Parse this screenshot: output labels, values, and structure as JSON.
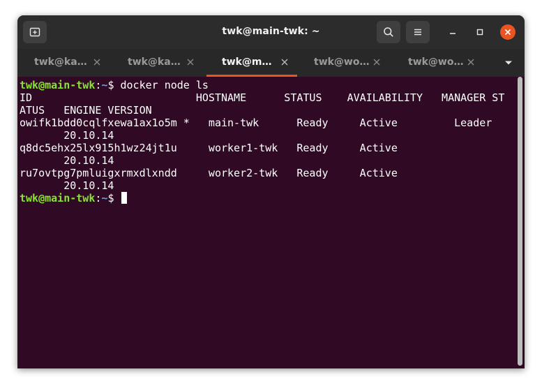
{
  "window": {
    "title": "twk@main-twk: ~"
  },
  "tabs": [
    {
      "label": "twk@ka…",
      "active": false
    },
    {
      "label": "twk@ka…",
      "active": false
    },
    {
      "label": "twk@m…",
      "active": true
    },
    {
      "label": "twk@wo…",
      "active": false
    },
    {
      "label": "twk@wo…",
      "active": false
    }
  ],
  "terminal": {
    "prompt_user": "twk@main-twk",
    "prompt_sep": ":",
    "prompt_path": "~",
    "prompt_symbol": "$ ",
    "command": "docker node ls",
    "output_lines": [
      "ID                          HOSTNAME      STATUS    AVAILABILITY   MANAGER ST",
      "ATUS   ENGINE VERSION",
      "owifk1bdd0cqlfxewa1ax1o5m *   main-twk      Ready     Active         Leader",
      "       20.10.14",
      "q8dc5ehx25lx915h1wz24jt1u     worker1-twk   Ready     Active",
      "       20.10.14",
      "ru7ovtpg7pmluigxrmxdlxndd     worker2-twk   Ready     Active",
      "       20.10.14"
    ]
  },
  "colors": {
    "terminal_bg": "#300a24",
    "prompt_user": "#8ae234",
    "prompt_path": "#729fcf",
    "accent": "#e95420",
    "close_button": "#e95420"
  },
  "icons": {
    "new_tab": "new-tab-icon",
    "search": "search-icon",
    "menu": "hamburger-menu-icon",
    "minimize": "minimize-icon",
    "maximize": "maximize-icon",
    "close": "close-icon",
    "tab_close": "tab-close-icon",
    "tab_list": "chevron-down-icon"
  }
}
